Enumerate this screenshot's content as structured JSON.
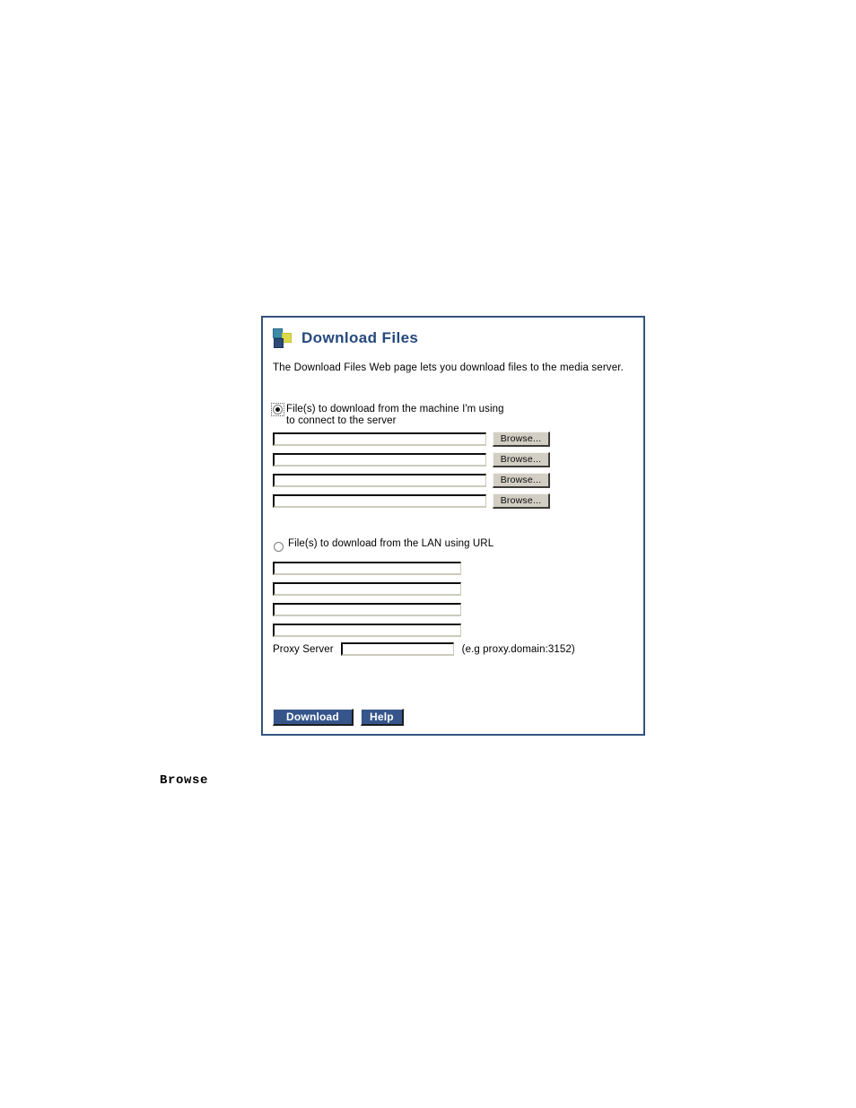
{
  "panel": {
    "title": "Download Files",
    "logo_icon": "three-squares-logo-icon",
    "description": "The Download Files Web page lets you download files to the media server.",
    "border_color": "#34537f",
    "title_color": "#24497d"
  },
  "local_section": {
    "radio_name": "download-source",
    "radio_label": "File(s) to download from the machine I'm using\nto connect to the server",
    "radio_selected": true,
    "rows": [
      {
        "value": "",
        "placeholder": "",
        "browse_label": "Browse..."
      },
      {
        "value": "",
        "placeholder": "",
        "browse_label": "Browse..."
      },
      {
        "value": "",
        "placeholder": "",
        "browse_label": "Browse..."
      },
      {
        "value": "",
        "placeholder": "",
        "browse_label": "Browse..."
      }
    ]
  },
  "lan_section": {
    "radio_label": "File(s) to download from the LAN using URL",
    "radio_selected": false,
    "url_rows": [
      {
        "value": "",
        "placeholder": ""
      },
      {
        "value": "",
        "placeholder": ""
      },
      {
        "value": "",
        "placeholder": ""
      },
      {
        "value": "",
        "placeholder": ""
      }
    ],
    "proxy": {
      "label": "Proxy Server",
      "value": "",
      "placeholder": "",
      "hint": "(e.g proxy.domain:3152)"
    }
  },
  "actions": {
    "download_label": "Download",
    "help_label": "Help",
    "button_color": "#35558b"
  },
  "caption": {
    "text": "Browse"
  }
}
